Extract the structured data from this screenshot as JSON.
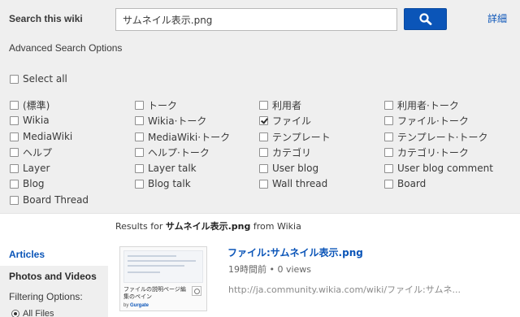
{
  "search": {
    "title": "Search this wiki",
    "query": "サムネイル表示.png",
    "button_icon": "search-icon",
    "advanced_link": "詳細"
  },
  "advanced": {
    "title": "Advanced Search Options",
    "select_all": {
      "label": "Select all",
      "checked": false
    },
    "columns": [
      [
        {
          "label": "(標準)",
          "checked": false
        },
        {
          "label": "Wikia",
          "checked": false
        },
        {
          "label": "MediaWiki",
          "checked": false
        },
        {
          "label": "ヘルプ",
          "checked": false
        },
        {
          "label": "Layer",
          "checked": false
        },
        {
          "label": "Blog",
          "checked": false
        },
        {
          "label": "Board Thread",
          "checked": false
        }
      ],
      [
        {
          "label": "トーク",
          "checked": false
        },
        {
          "label": "Wikia·トーク",
          "checked": false
        },
        {
          "label": "MediaWiki·トーク",
          "checked": false
        },
        {
          "label": "ヘルプ·トーク",
          "checked": false
        },
        {
          "label": "Layer talk",
          "checked": false
        },
        {
          "label": "Blog talk",
          "checked": false
        }
      ],
      [
        {
          "label": "利用者",
          "checked": false
        },
        {
          "label": "ファイル",
          "checked": true
        },
        {
          "label": "テンプレート",
          "checked": false
        },
        {
          "label": "カテゴリ",
          "checked": false
        },
        {
          "label": "User blog",
          "checked": false
        },
        {
          "label": "Wall thread",
          "checked": false
        }
      ],
      [
        {
          "label": "利用者·トーク",
          "checked": false
        },
        {
          "label": "ファイル·トーク",
          "checked": false
        },
        {
          "label": "テンプレート·トーク",
          "checked": false
        },
        {
          "label": "カテゴリ·トーク",
          "checked": false
        },
        {
          "label": "User blog comment",
          "checked": false
        },
        {
          "label": "Board",
          "checked": false
        }
      ]
    ]
  },
  "results_header": {
    "prefix": "Results for ",
    "query": "サムネイル表示.png",
    "suffix": " from Wikia"
  },
  "sidebar": {
    "articles": "Articles",
    "photos_videos": "Photos and Videos",
    "filtering_options": "Filtering Options:",
    "radio_all_files": "All Files"
  },
  "result": {
    "title": "ファイル:サムネイル表示.png",
    "meta": "19時間前 • 0 views",
    "url": "http://ja.community.wikia.com/wiki/ファイル:サムネ...",
    "thumb_caption": "ファイルの説明ページ編集のペイン",
    "thumb_by": "by ",
    "thumb_author": "Gurgate"
  }
}
